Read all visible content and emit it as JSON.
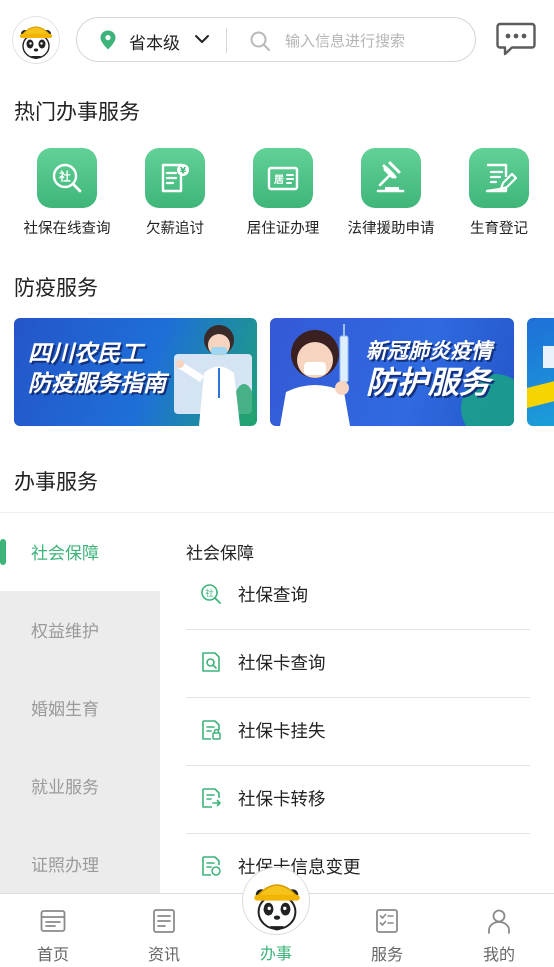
{
  "header": {
    "location_label": "省本级",
    "search_placeholder": "输入信息进行搜索"
  },
  "hot_services": {
    "title": "热门办事服务",
    "items": [
      {
        "label": "社保在线查询",
        "icon": "social-security-search-icon"
      },
      {
        "label": "欠薪追讨",
        "icon": "wage-document-icon"
      },
      {
        "label": "居住证办理",
        "icon": "residence-card-icon"
      },
      {
        "label": "法律援助申请",
        "icon": "gavel-icon"
      },
      {
        "label": "生育登记",
        "icon": "edit-document-icon"
      }
    ]
  },
  "epidemic": {
    "title": "防疫服务",
    "banners": [
      {
        "line1": "四川农民工",
        "line2": "防疫服务指南"
      },
      {
        "line1": "新冠肺炎疫情",
        "line2": "防护服务"
      }
    ]
  },
  "services": {
    "title": "办事服务",
    "categories": [
      "社会保障",
      "权益维护",
      "婚姻生育",
      "就业服务",
      "证照办理"
    ],
    "active_category": "社会保障",
    "content_title": "社会保障",
    "items": [
      {
        "label": "社保查询",
        "icon": "social-security-search-icon"
      },
      {
        "label": "社保卡查询",
        "icon": "card-search-icon"
      },
      {
        "label": "社保卡挂失",
        "icon": "card-lock-icon"
      },
      {
        "label": "社保卡转移",
        "icon": "card-transfer-icon"
      },
      {
        "label": "社保卡信息变更",
        "icon": "card-edit-icon"
      }
    ]
  },
  "bottom_nav": [
    {
      "label": "首页",
      "icon": "home-icon"
    },
    {
      "label": "资讯",
      "icon": "news-icon"
    },
    {
      "label": "办事",
      "icon": "mascot-icon",
      "active": true
    },
    {
      "label": "服务",
      "icon": "service-list-icon"
    },
    {
      "label": "我的",
      "icon": "user-icon"
    }
  ],
  "colors": {
    "accent": "#3db37a",
    "banner_blue": "#2455c9"
  }
}
